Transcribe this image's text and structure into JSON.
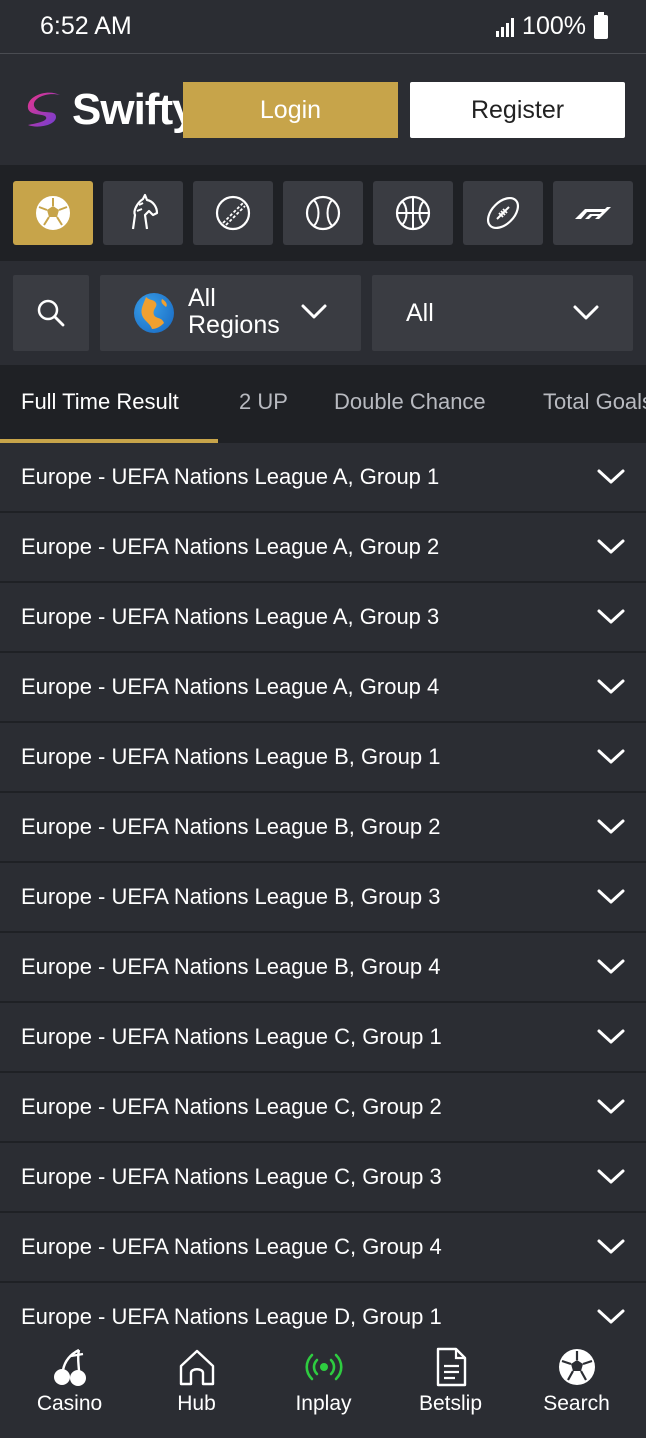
{
  "status_bar": {
    "time": "6:52 AM",
    "battery": "100%"
  },
  "header": {
    "brand": "Swifty",
    "login_label": "Login",
    "register_label": "Register"
  },
  "sports": [
    "soccer",
    "horse-racing",
    "cricket",
    "tennis",
    "basketball",
    "american-football",
    "formula-1"
  ],
  "filters": {
    "region_label": "All Regions",
    "market_label": "All"
  },
  "tabs": [
    {
      "label": "Full Time Result",
      "active": true
    },
    {
      "label": "2 UP"
    },
    {
      "label": "Double Chance"
    },
    {
      "label": "Total Goals"
    }
  ],
  "leagues": [
    "Europe - UEFA Nations League A, Group 1",
    "Europe - UEFA Nations League A, Group 2",
    "Europe - UEFA Nations League A, Group 3",
    "Europe - UEFA Nations League A, Group 4",
    "Europe - UEFA Nations League B, Group 1",
    "Europe - UEFA Nations League B, Group 2",
    "Europe - UEFA Nations League B, Group 3",
    "Europe - UEFA Nations League B, Group 4",
    "Europe - UEFA Nations League C, Group 1",
    "Europe - UEFA Nations League C, Group 2",
    "Europe - UEFA Nations League C, Group 3",
    "Europe - UEFA Nations League C, Group 4",
    "Europe - UEFA Nations League D, Group 1"
  ],
  "bottom_nav": [
    {
      "label": "Casino",
      "icon": "cherries-icon"
    },
    {
      "label": "Hub",
      "icon": "home-icon"
    },
    {
      "label": "Inplay",
      "icon": "live-broadcast-icon"
    },
    {
      "label": "Betslip",
      "icon": "document-icon"
    },
    {
      "label": "Search",
      "icon": "soccer-ball-icon"
    }
  ],
  "colors": {
    "accent": "#c7a44a",
    "background": "#2b2d33",
    "inplay": "#2ecc40"
  }
}
